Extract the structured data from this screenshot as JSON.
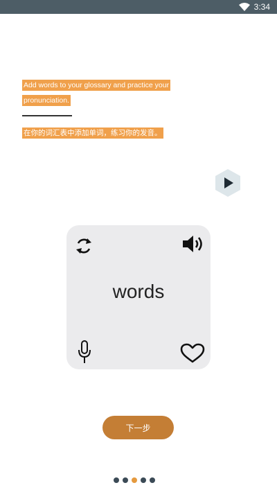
{
  "status_bar": {
    "time": "3:34",
    "wifi_icon": "wifi-icon"
  },
  "intro": {
    "english_text": "Add words to your glossary and practice your pronunciation.",
    "chinese_text": "在你的词汇表中添加单词，练习你的发音。"
  },
  "play_button": {
    "icon": "play-icon"
  },
  "card": {
    "word": "words",
    "icons": [
      "refresh-icon",
      "speaker-icon",
      "microphone-icon",
      "heart-icon"
    ]
  },
  "next_button": {
    "label": "下一步"
  },
  "pagination": {
    "count": 5,
    "active_index": 2
  },
  "colors": {
    "status_bar": "#4d5d66",
    "highlight": "#f0a04b",
    "card_bg": "#ebebed",
    "button": "#c47e35",
    "dot": "#3b4a56",
    "dot_active": "#e59a3f",
    "play_hexagon": "#dde6ea"
  }
}
